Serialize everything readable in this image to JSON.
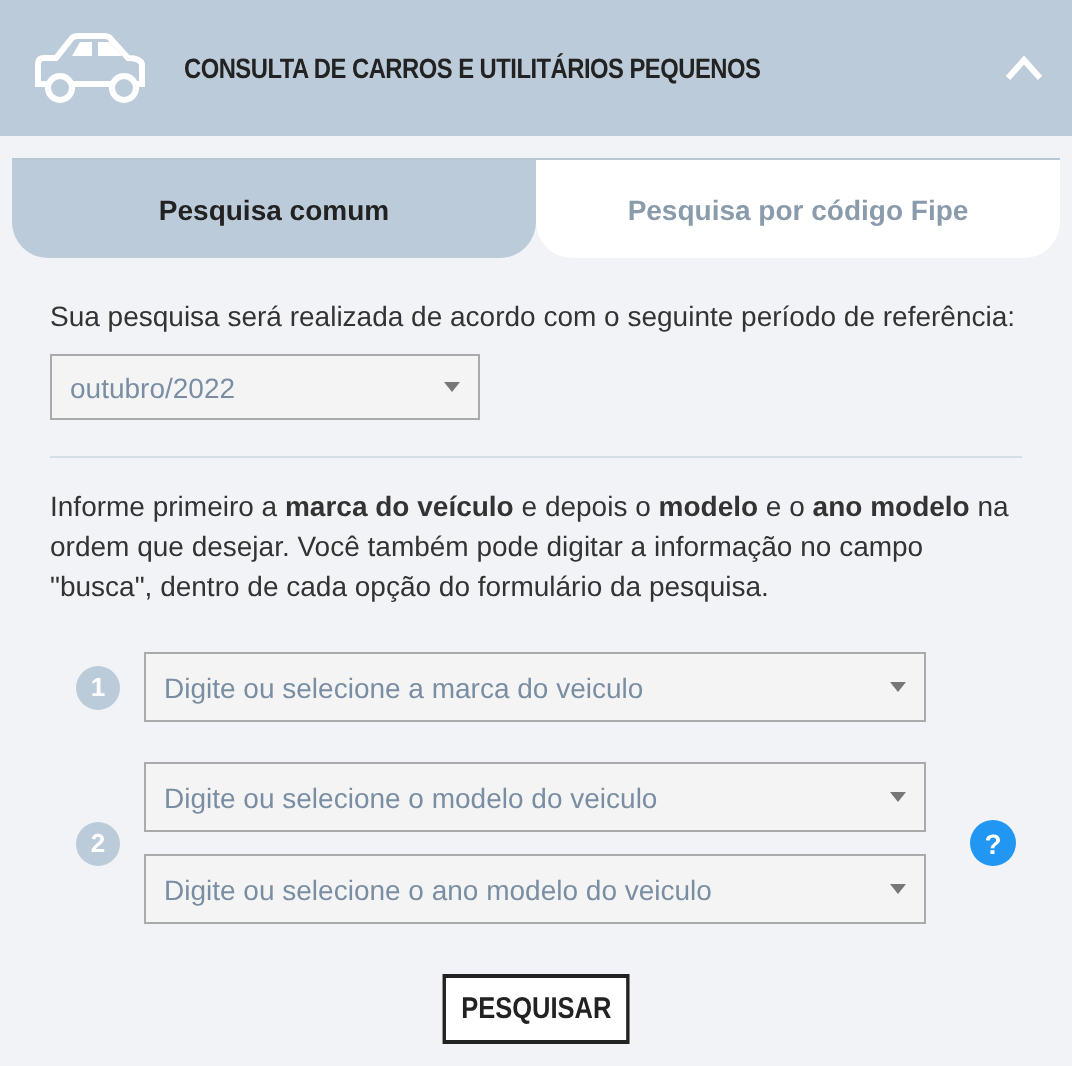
{
  "header": {
    "title": "CONSULTA DE CARROS E UTILITÁRIOS PEQUENOS",
    "expanded": true
  },
  "tabs": [
    {
      "label": "Pesquisa comum",
      "selected": true
    },
    {
      "label": "Pesquisa por código Fipe",
      "selected": false
    }
  ],
  "period": {
    "label": "Sua pesquisa será realizada de acordo com o seguinte período de referência:",
    "value": "outubro/2022"
  },
  "instructions": "Informe primeiro a **marca do veículo** e depois o **modelo** e o **ano modelo** na ordem que desejar. Você também pode digitar a informação no campo \"busca\", dentro de cada opção do formulário da pesquisa.",
  "steps": [
    {
      "number": "1",
      "fields": [
        {
          "placeholder": "Digite ou selecione a marca do veiculo"
        }
      ]
    },
    {
      "number": "2",
      "fields": [
        {
          "placeholder": "Digite ou selecione o modelo do veiculo"
        },
        {
          "placeholder": "Digite ou selecione o ano modelo do veiculo"
        }
      ],
      "help": "?"
    }
  ],
  "search_button": "PESQUISAR"
}
